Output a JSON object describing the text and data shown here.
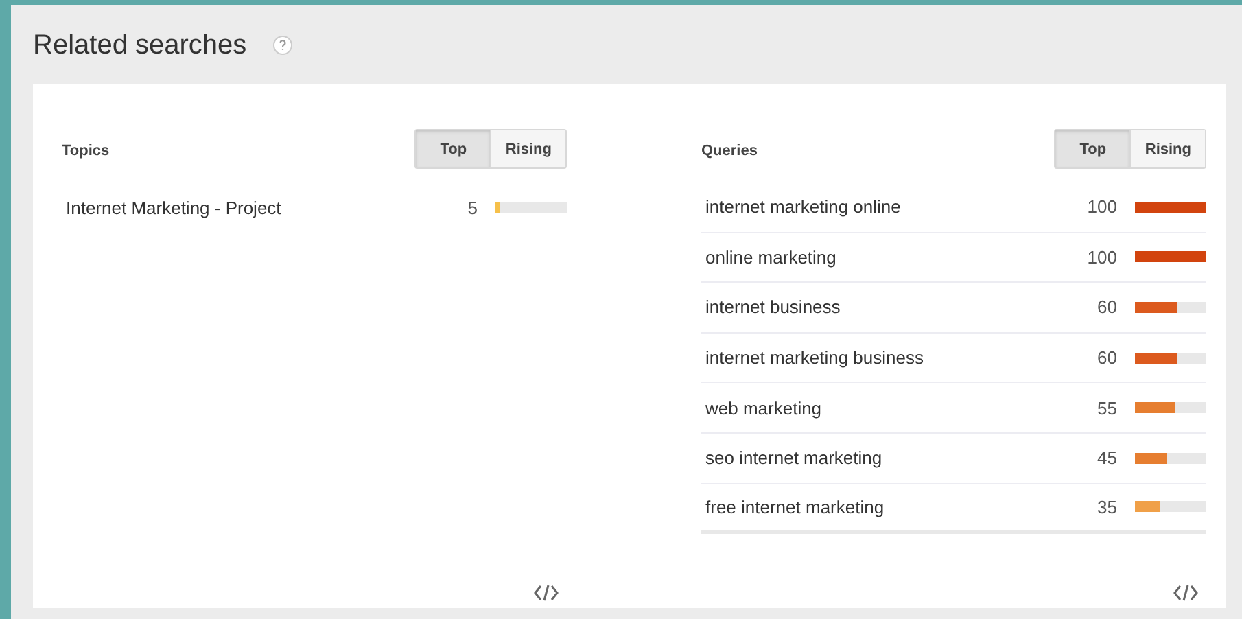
{
  "title": "Related searches",
  "sections": [
    {
      "heading": "Topics",
      "toggle": [
        {
          "label": "Top",
          "selected": true
        },
        {
          "label": "Rising",
          "selected": false
        }
      ],
      "divided": false,
      "rows": [
        {
          "label": "Internet Marketing - Project",
          "value": "5",
          "level": 0.05,
          "color": "#f6c04a"
        }
      ]
    },
    {
      "heading": "Queries",
      "toggle": [
        {
          "label": "Top",
          "selected": true
        },
        {
          "label": "Rising",
          "selected": false
        }
      ],
      "divided": true,
      "rows": [
        {
          "label": "internet marketing online",
          "value": "100",
          "level": 1.0,
          "color": "#d2440e"
        },
        {
          "label": "online marketing",
          "value": "100",
          "level": 1.0,
          "color": "#d2440e"
        },
        {
          "label": "internet business",
          "value": "60",
          "level": 0.6,
          "color": "#dc5a1e"
        },
        {
          "label": "internet marketing business",
          "value": "60",
          "level": 0.6,
          "color": "#dc5a1e"
        },
        {
          "label": "web marketing",
          "value": "55",
          "level": 0.55,
          "color": "#e67e30"
        },
        {
          "label": "seo internet marketing",
          "value": "45",
          "level": 0.45,
          "color": "#e67e30"
        },
        {
          "label": "free internet marketing",
          "value": "35",
          "level": 0.35,
          "color": "#f0a048"
        }
      ]
    }
  ]
}
